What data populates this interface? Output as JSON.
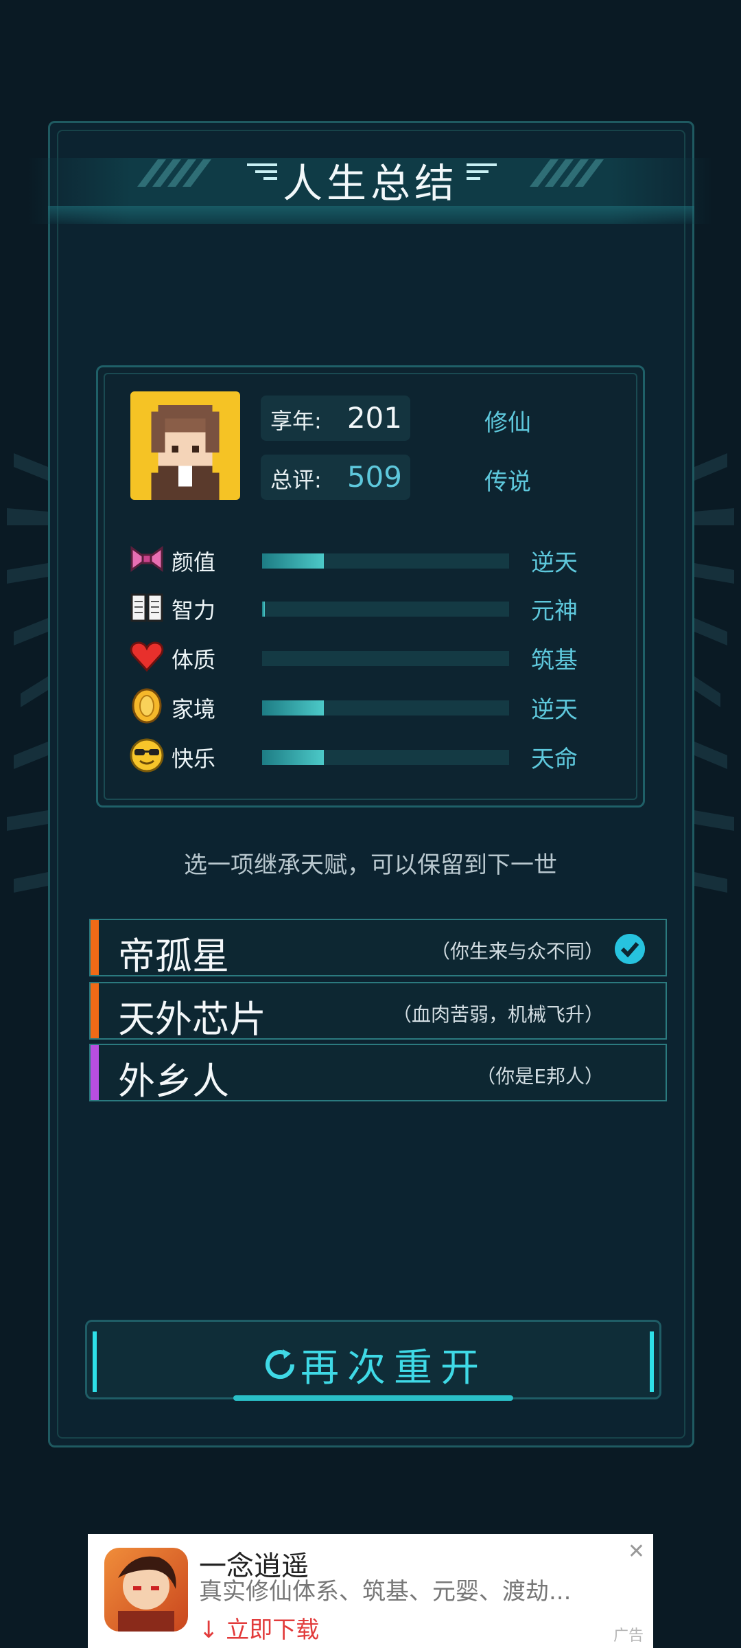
{
  "summary": {
    "title": "人生总结",
    "age_label": "享年:",
    "age_value": "201",
    "age_tag": "修仙",
    "score_label": "总评:",
    "score_value": "509",
    "score_tag": "传说"
  },
  "stats": [
    {
      "label": "颜值",
      "grade": "逆天",
      "level": 0.25,
      "icon": "bow-icon"
    },
    {
      "label": "智力",
      "grade": "元神",
      "level": 0.01,
      "icon": "book-icon"
    },
    {
      "label": "体质",
      "grade": "筑基",
      "level": 0.0,
      "icon": "heart-icon"
    },
    {
      "label": "家境",
      "grade": "逆天",
      "level": 0.25,
      "icon": "coin-icon"
    },
    {
      "label": "快乐",
      "grade": "天命",
      "level": 0.25,
      "icon": "sunglasses-face-icon"
    }
  ],
  "hint": "选一项继承天赋，可以保留到下一世",
  "talents": [
    {
      "name": "帝孤星",
      "desc": "（你生来与众不同）",
      "color": "#f06a17",
      "selected": true
    },
    {
      "name": "天外芯片",
      "desc": "（血肉苦弱，机械飞升）",
      "color": "#f06a17",
      "selected": false
    },
    {
      "name": "外乡人",
      "desc": "（你是E邦人）",
      "color": "#b84ee0",
      "selected": false
    }
  ],
  "restart_label": "再次重开",
  "ad": {
    "title": "一念逍遥",
    "desc": "真实修仙体系、筑基、元婴、渡劫...",
    "cta": "↓ 立即下载",
    "tag": "广告"
  },
  "colors": {
    "accent": "#5ec8dc",
    "background": "#0a1a24",
    "bar_fill": "#4cc9c8"
  }
}
